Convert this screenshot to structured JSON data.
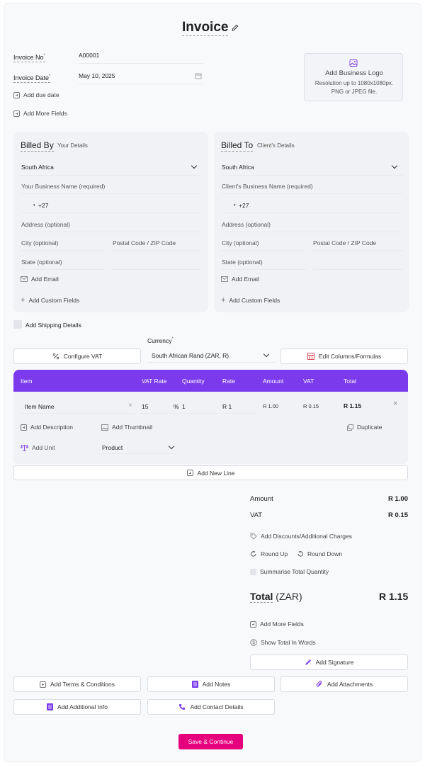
{
  "header": {
    "title": "Invoice"
  },
  "invoice": {
    "number_label": "Invoice No",
    "number_value": "A00001",
    "date_label": "Invoice Date",
    "date_value": "May 10, 2025",
    "required_mark": "*",
    "add_due_date": "Add due date",
    "add_more_fields": "Add More Fields"
  },
  "logo": {
    "title": "Add Business Logo",
    "line1": "Resolution up to 1080x1080px.",
    "line2": "PNG or JPEG file."
  },
  "billed_by": {
    "title": "Billed By",
    "subtitle": "Your Details",
    "country": "South Africa",
    "business_name": "Your Business Name (required)",
    "phone_code": "+27",
    "address": "Address (optional)",
    "city": "City (optional)",
    "postal": "Postal Code / ZIP Code",
    "state": "State (optional)",
    "add_email": "Add Email",
    "add_custom": "Add Custom Fields"
  },
  "billed_to": {
    "title": "Billed To",
    "subtitle": "Client's Details",
    "country": "South Africa",
    "business_name": "Client's Business Name (required)",
    "phone_code": "+27",
    "address": "Address (optional)",
    "city": "City (optional)",
    "postal": "Postal Code / ZIP Code",
    "state": "State (optional)",
    "add_email": "Add Email",
    "add_custom": "Add Custom Fields"
  },
  "shipping": {
    "label": "Add Shipping Details",
    "checked": false
  },
  "currency": {
    "label": "Currency",
    "required_mark": "*",
    "value": "South African Rand (ZAR, R)"
  },
  "toolbar": {
    "configure_vat": "Configure VAT",
    "edit_columns": "Edit Columns/Formulas"
  },
  "table": {
    "headers": [
      "Item",
      "VAT Rate",
      "Quantity",
      "Rate",
      "Amount",
      "VAT",
      "Total"
    ],
    "row": {
      "item_name": "Item Name",
      "vat_rate": "15",
      "percent": "%",
      "quantity": "1",
      "rate": "R 1",
      "amount": "R 1.00",
      "vat": "R 0.15",
      "total": "R 1.15",
      "add_description": "Add Description",
      "add_thumbnail": "Add Thumbnail",
      "duplicate": "Duplicate",
      "add_unit": "Add Unit",
      "unit_value": "Product"
    },
    "add_new_line": "Add New Line"
  },
  "summary": {
    "amount_label": "Amount",
    "amount_value": "R 1.00",
    "vat_label": "VAT",
    "vat_value": "R 0.15",
    "add_discounts": "Add Discounts/Additional Charges",
    "round_up": "Round Up",
    "round_down": "Round Down",
    "summarise_qty": "Summarise Total Quantity",
    "total_label": "Total",
    "total_currency": "(ZAR)",
    "total_value": "R 1.15",
    "add_more_fields": "Add More Fields",
    "show_total_words": "Show Total In Words",
    "add_signature": "Add Signature"
  },
  "extras": {
    "terms": "Add Terms & Conditions",
    "notes": "Add Notes",
    "attachments": "Add Attachments",
    "additional_info": "Add Additional Info",
    "contact_details": "Add Contact Details"
  },
  "footer": {
    "save_continue": "Save & Continue"
  },
  "colors": {
    "accent": "#7c3aed",
    "primary_button": "#e6007e"
  }
}
